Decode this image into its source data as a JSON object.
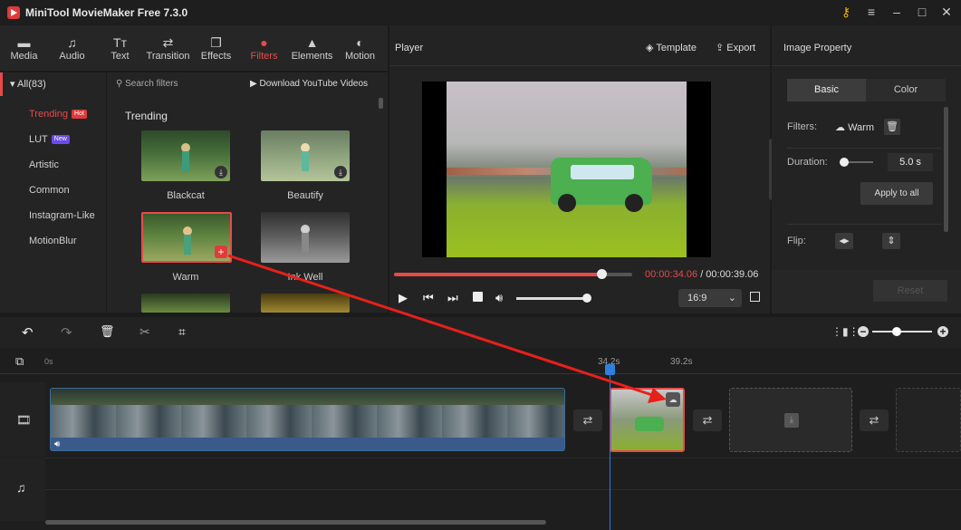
{
  "app": {
    "title": "MiniTool MovieMaker Free 7.3.0"
  },
  "toolbar": [
    {
      "label": "Media",
      "icon": "folder-icon"
    },
    {
      "label": "Audio",
      "icon": "music-note-icon"
    },
    {
      "label": "Text",
      "icon": "text-icon"
    },
    {
      "label": "Transition",
      "icon": "transition-icon"
    },
    {
      "label": "Effects",
      "icon": "effects-icon"
    },
    {
      "label": "Filters",
      "icon": "filters-icon"
    },
    {
      "label": "Elements",
      "icon": "elements-icon"
    },
    {
      "label": "Motion",
      "icon": "motion-icon"
    }
  ],
  "categories": {
    "all_label": "All(83)",
    "items": [
      {
        "label": "Trending",
        "badge": "Hot"
      },
      {
        "label": "LUT",
        "badge": "New"
      },
      {
        "label": "Artistic",
        "badge": ""
      },
      {
        "label": "Common",
        "badge": ""
      },
      {
        "label": "Instagram-Like",
        "badge": ""
      },
      {
        "label": "MotionBlur",
        "badge": ""
      }
    ]
  },
  "filters": {
    "search_placeholder": "Search filters",
    "download_link": "Download YouTube Videos",
    "section": "Trending",
    "items": [
      "Blackcat",
      "Beautify",
      "Warm",
      "Ink Well"
    ]
  },
  "player": {
    "title": "Player",
    "template_label": "Template",
    "export_label": "Export",
    "current_time": "00:00:34.06",
    "total_time": "/ 00:00:39.06",
    "progress": 0.87,
    "volume": 1.0,
    "aspect": "16:9"
  },
  "props": {
    "title": "Image Property",
    "tab_basic": "Basic",
    "tab_color": "Color",
    "filters_label": "Filters:",
    "filter_value": "Warm",
    "duration_label": "Duration:",
    "duration_value": "5.0 s",
    "apply_all": "Apply to all",
    "flip_label": "Flip:",
    "reset": "Reset"
  },
  "timeline": {
    "ruler_start": "0s",
    "marker_time": "34.2s",
    "end_time": "39.2s"
  }
}
